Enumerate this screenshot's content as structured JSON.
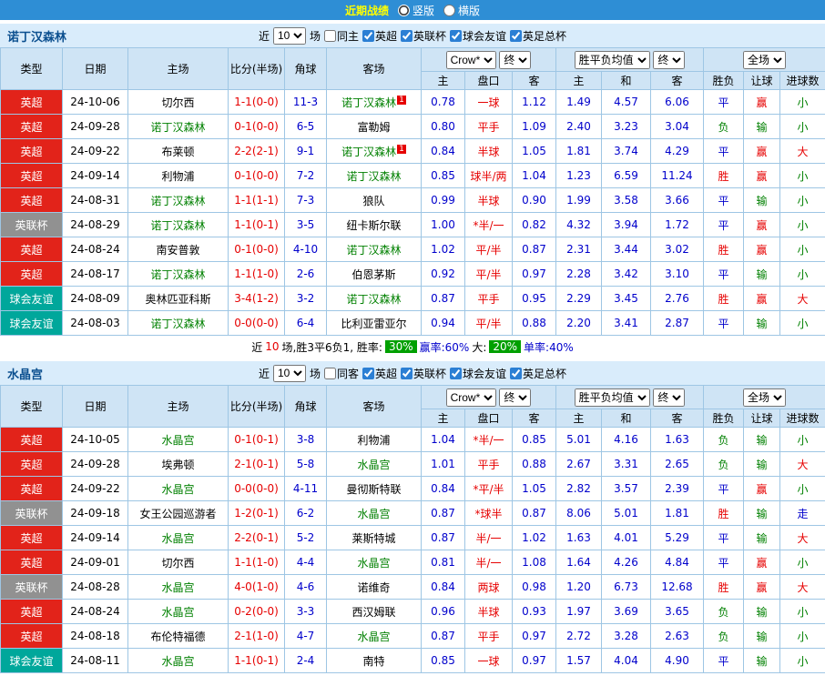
{
  "top_bar": {
    "title": "近期战绩",
    "vertical_label": "竖版",
    "horizontal_label": "横版"
  },
  "colors": {
    "topbar_blue": "#2e8ed5",
    "title_yellow": "#ffff00",
    "league_epl_red": "#e2231a",
    "league_cup_gray": "#919191",
    "league_friendly_teal": "#00a79b",
    "win_red": "#e60000",
    "draw_blue": "#0000cc",
    "lose_green": "#008000",
    "focus_team_green": "#008000",
    "rate_badge_green": "#00a000",
    "header_bg": "#cfe4f5",
    "teambar_bg": "#d9ecfb"
  },
  "sections": [
    {
      "team": "诺丁汉森林",
      "filter": {
        "near": "近",
        "count": "10",
        "games": "场",
        "same": "同主",
        "leagues": [
          "英超",
          "英联杯",
          "球会友谊",
          "英足总杯"
        ]
      },
      "columns": {
        "type": "类型",
        "date": "日期",
        "home": "主场",
        "score": "比分(半场)",
        "corner": "角球",
        "away": "客场",
        "odds_source": "Crow*",
        "final": "终",
        "europe": "胜平负均值",
        "final2": "终",
        "scope": "全场",
        "sub": [
          "主",
          "盘口",
          "客",
          "主",
          "和",
          "客",
          "胜负",
          "让球",
          "进球数"
        ]
      },
      "rows": [
        {
          "type": "英超",
          "date": "24-10-06",
          "home": "切尔西",
          "score": "1-1(0-0)",
          "corner": "11-3",
          "away": "诺丁汉森林",
          "away_sup": "1",
          "o1": "0.78",
          "pan": "一球",
          "o2": "1.12",
          "e1": "1.49",
          "e2": "4.57",
          "e3": "6.06",
          "res": "平",
          "rq": "赢",
          "goal": "小"
        },
        {
          "type": "英超",
          "date": "24-09-28",
          "home": "诺丁汉森林",
          "score": "0-1(0-0)",
          "corner": "6-5",
          "away": "富勒姆",
          "o1": "0.80",
          "pan": "平手",
          "o2": "1.09",
          "e1": "2.40",
          "e2": "3.23",
          "e3": "3.04",
          "res": "负",
          "rq": "输",
          "goal": "小"
        },
        {
          "type": "英超",
          "date": "24-09-22",
          "home": "布莱顿",
          "score": "2-2(2-1)",
          "corner": "9-1",
          "away": "诺丁汉森林",
          "away_sup": "1",
          "o1": "0.84",
          "pan": "半球",
          "o2": "1.05",
          "e1": "1.81",
          "e2": "3.74",
          "e3": "4.29",
          "res": "平",
          "rq": "赢",
          "goal": "大"
        },
        {
          "type": "英超",
          "date": "24-09-14",
          "home": "利物浦",
          "score": "0-1(0-0)",
          "corner": "7-2",
          "away": "诺丁汉森林",
          "o1": "0.85",
          "pan": "球半/两",
          "o2": "1.04",
          "e1": "1.23",
          "e2": "6.59",
          "e3": "11.24",
          "res": "胜",
          "rq": "赢",
          "goal": "小"
        },
        {
          "type": "英超",
          "date": "24-08-31",
          "home": "诺丁汉森林",
          "score": "1-1(1-1)",
          "corner": "7-3",
          "away": "狼队",
          "o1": "0.99",
          "pan": "半球",
          "o2": "0.90",
          "e1": "1.99",
          "e2": "3.58",
          "e3": "3.66",
          "res": "平",
          "rq": "输",
          "goal": "小"
        },
        {
          "type": "英联杯",
          "date": "24-08-29",
          "home": "诺丁汉森林",
          "score": "1-1(0-1)",
          "corner": "3-5",
          "away": "纽卡斯尔联",
          "o1": "1.00",
          "pan": "*半/一",
          "o2": "0.82",
          "e1": "4.32",
          "e2": "3.94",
          "e3": "1.72",
          "res": "平",
          "rq": "赢",
          "goal": "小"
        },
        {
          "type": "英超",
          "date": "24-08-24",
          "home": "南安普敦",
          "score": "0-1(0-0)",
          "corner": "4-10",
          "away": "诺丁汉森林",
          "o1": "1.02",
          "pan": "平/半",
          "o2": "0.87",
          "e1": "2.31",
          "e2": "3.44",
          "e3": "3.02",
          "res": "胜",
          "rq": "赢",
          "goal": "小"
        },
        {
          "type": "英超",
          "date": "24-08-17",
          "home": "诺丁汉森林",
          "score": "1-1(1-0)",
          "corner": "2-6",
          "away": "伯恩茅斯",
          "o1": "0.92",
          "pan": "平/半",
          "o2": "0.97",
          "e1": "2.28",
          "e2": "3.42",
          "e3": "3.10",
          "res": "平",
          "rq": "输",
          "goal": "小"
        },
        {
          "type": "球会友谊",
          "date": "24-08-09",
          "home": "奥林匹亚科斯",
          "score": "3-4(1-2)",
          "corner": "3-2",
          "away": "诺丁汉森林",
          "o1": "0.87",
          "pan": "平手",
          "o2": "0.95",
          "e1": "2.29",
          "e2": "3.45",
          "e3": "2.76",
          "res": "胜",
          "rq": "赢",
          "goal": "大"
        },
        {
          "type": "球会友谊",
          "date": "24-08-03",
          "home": "诺丁汉森林",
          "score": "0-0(0-0)",
          "corner": "6-4",
          "away": "比利亚雷亚尔",
          "o1": "0.94",
          "pan": "平/半",
          "o2": "0.88",
          "e1": "2.20",
          "e2": "3.41",
          "e3": "2.87",
          "res": "平",
          "rq": "输",
          "goal": "小"
        }
      ],
      "summary": {
        "near": "近",
        "count": "10",
        "record": "场,胜3平6负1, 胜率:",
        "win_rate": "30%",
        "handicap": "赢率:60%",
        "big_label": "大:",
        "big_rate": "20%",
        "single": "单率:40%"
      }
    },
    {
      "team": "水晶宫",
      "filter": {
        "near": "近",
        "count": "10",
        "games": "场",
        "same": "同客",
        "leagues": [
          "英超",
          "英联杯",
          "球会友谊",
          "英足总杯"
        ]
      },
      "columns": {
        "type": "类型",
        "date": "日期",
        "home": "主场",
        "score": "比分(半场)",
        "corner": "角球",
        "away": "客场",
        "odds_source": "Crow*",
        "final": "终",
        "europe": "胜平负均值",
        "final2": "终",
        "scope": "全场",
        "sub": [
          "主",
          "盘口",
          "客",
          "主",
          "和",
          "客",
          "胜负",
          "让球",
          "进球数"
        ]
      },
      "rows": [
        {
          "type": "英超",
          "date": "24-10-05",
          "home": "水晶宫",
          "score": "0-1(0-1)",
          "corner": "3-8",
          "away": "利物浦",
          "o1": "1.04",
          "pan": "*半/一",
          "o2": "0.85",
          "e1": "5.01",
          "e2": "4.16",
          "e3": "1.63",
          "res": "负",
          "rq": "输",
          "goal": "小"
        },
        {
          "type": "英超",
          "date": "24-09-28",
          "home": "埃弗顿",
          "score": "2-1(0-1)",
          "corner": "5-8",
          "away": "水晶宫",
          "o1": "1.01",
          "pan": "平手",
          "o2": "0.88",
          "e1": "2.67",
          "e2": "3.31",
          "e3": "2.65",
          "res": "负",
          "rq": "输",
          "goal": "大"
        },
        {
          "type": "英超",
          "date": "24-09-22",
          "home": "水晶宫",
          "score": "0-0(0-0)",
          "corner": "4-11",
          "away": "曼彻斯特联",
          "o1": "0.84",
          "pan": "*平/半",
          "o2": "1.05",
          "e1": "2.82",
          "e2": "3.57",
          "e3": "2.39",
          "res": "平",
          "rq": "赢",
          "goal": "小"
        },
        {
          "type": "英联杯",
          "date": "24-09-18",
          "home": "女王公园巡游者",
          "score": "1-2(0-1)",
          "corner": "6-2",
          "away": "水晶宫",
          "o1": "0.87",
          "pan": "*球半",
          "o2": "0.87",
          "e1": "8.06",
          "e2": "5.01",
          "e3": "1.81",
          "res": "胜",
          "rq": "输",
          "goal": "走"
        },
        {
          "type": "英超",
          "date": "24-09-14",
          "home": "水晶宫",
          "score": "2-2(0-1)",
          "corner": "5-2",
          "away": "莱斯特城",
          "o1": "0.87",
          "pan": "半/一",
          "o2": "1.02",
          "e1": "1.63",
          "e2": "4.01",
          "e3": "5.29",
          "res": "平",
          "rq": "输",
          "goal": "大"
        },
        {
          "type": "英超",
          "date": "24-09-01",
          "home": "切尔西",
          "score": "1-1(1-0)",
          "corner": "4-4",
          "away": "水晶宫",
          "o1": "0.81",
          "pan": "半/一",
          "o2": "1.08",
          "e1": "1.64",
          "e2": "4.26",
          "e3": "4.84",
          "res": "平",
          "rq": "赢",
          "goal": "小"
        },
        {
          "type": "英联杯",
          "date": "24-08-28",
          "home": "水晶宫",
          "score": "4-0(1-0)",
          "corner": "4-6",
          "away": "诺维奇",
          "o1": "0.84",
          "pan": "两球",
          "o2": "0.98",
          "e1": "1.20",
          "e2": "6.73",
          "e3": "12.68",
          "res": "胜",
          "rq": "赢",
          "goal": "大"
        },
        {
          "type": "英超",
          "date": "24-08-24",
          "home": "水晶宫",
          "score": "0-2(0-0)",
          "corner": "3-3",
          "away": "西汉姆联",
          "o1": "0.96",
          "pan": "半球",
          "o2": "0.93",
          "e1": "1.97",
          "e2": "3.69",
          "e3": "3.65",
          "res": "负",
          "rq": "输",
          "goal": "小"
        },
        {
          "type": "英超",
          "date": "24-08-18",
          "home": "布伦特福德",
          "score": "2-1(1-0)",
          "corner": "4-7",
          "away": "水晶宫",
          "o1": "0.87",
          "pan": "平手",
          "o2": "0.97",
          "e1": "2.72",
          "e2": "3.28",
          "e3": "2.63",
          "res": "负",
          "rq": "输",
          "goal": "小"
        },
        {
          "type": "球会友谊",
          "date": "24-08-11",
          "home": "水晶宫",
          "score": "1-1(0-1)",
          "corner": "2-4",
          "away": "南特",
          "o1": "0.85",
          "pan": "一球",
          "o2": "0.97",
          "e1": "1.57",
          "e2": "4.04",
          "e3": "4.90",
          "res": "平",
          "rq": "输",
          "goal": "小"
        }
      ]
    }
  ]
}
